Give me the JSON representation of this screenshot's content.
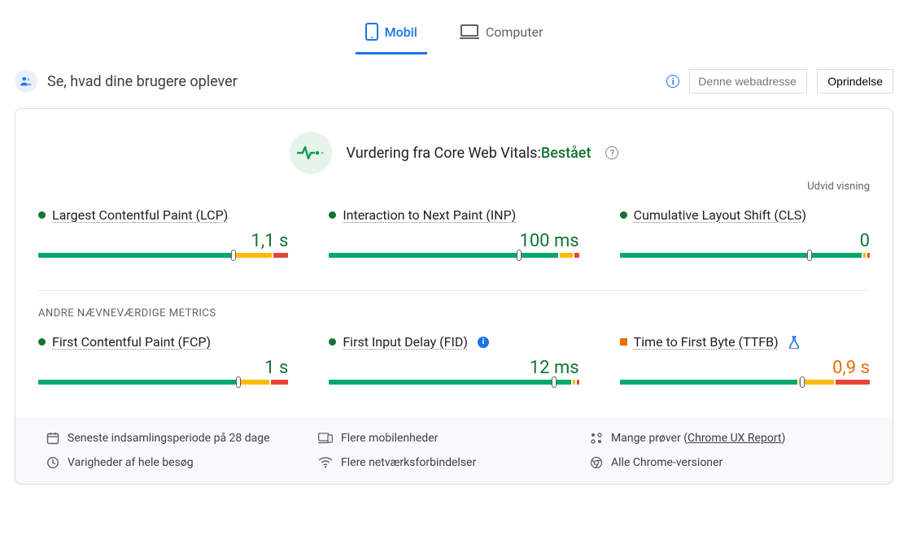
{
  "tabs": {
    "mobile": "Mobil",
    "desktop": "Computer"
  },
  "header": {
    "title": "Se, hvad dine brugere oplever",
    "url_placeholder": "Denne webadresse",
    "origin_button": "Oprindelse"
  },
  "assessment": {
    "label": "Vurdering fra Core Web Vitals:",
    "status": "Bestået",
    "expand": "Udvid visning"
  },
  "core_metrics": [
    {
      "name": "Largest Contentful Paint (LCP)",
      "value": "1,1 s",
      "status": "good",
      "bar": {
        "g": 78,
        "o": 16,
        "r": 6
      },
      "marker": 78
    },
    {
      "name": "Interaction to Next Paint (INP)",
      "value": "100 ms",
      "status": "good",
      "bar": {
        "g": 93,
        "o": 5,
        "r": 2
      },
      "marker": 76
    },
    {
      "name": "Cumulative Layout Shift (CLS)",
      "value": "0",
      "status": "good",
      "bar": {
        "g": 98,
        "o": 1,
        "r": 1
      },
      "marker": 76
    }
  ],
  "other_label": "ANDRE NÆVNEVÆRDIGE METRICS",
  "other_metrics": [
    {
      "name": "First Contentful Paint (FCP)",
      "value": "1 s",
      "status": "good",
      "bar": {
        "g": 80,
        "o": 13,
        "r": 7
      },
      "marker": 80,
      "badge": null
    },
    {
      "name": "First Input Delay (FID)",
      "value": "12 ms",
      "status": "good",
      "bar": {
        "g": 98,
        "o": 1,
        "r": 1
      },
      "marker": 90,
      "badge": "info"
    },
    {
      "name": "Time to First Byte (TTFB)",
      "value": "0,9 s",
      "status": "ni",
      "bar": {
        "g": 72,
        "o": 14,
        "r": 14
      },
      "marker": 73,
      "badge": "flask"
    }
  ],
  "footer": {
    "period": "Seneste indsamlingsperiode på 28 dage",
    "devices": "Flere mobilenheder",
    "samples_prefix": "Mange prøver",
    "samples_link": "Chrome UX Report",
    "durations": "Varigheder af hele besøg",
    "networks": "Flere netværksforbindelser",
    "versions": "Alle Chrome-versioner"
  }
}
